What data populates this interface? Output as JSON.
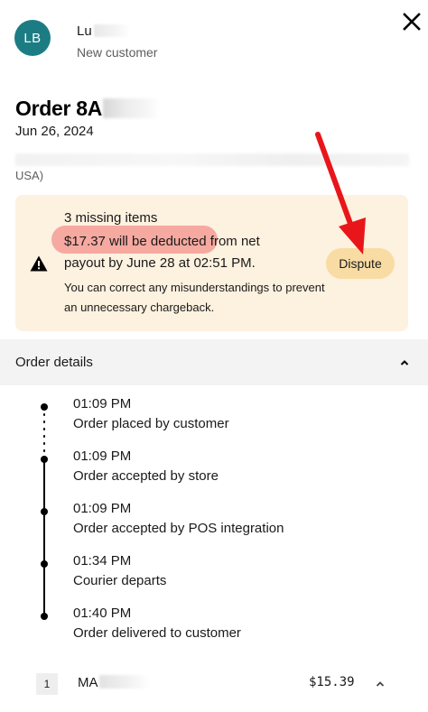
{
  "customer": {
    "initials": "LB",
    "name": "Lu",
    "status": "New customer"
  },
  "order": {
    "title_prefix": "Order 8A",
    "date": "Jun 26, 2024",
    "address_tail": "USA)"
  },
  "warning": {
    "title": "3 missing items",
    "highlighted_text": "$17.37 will be deducted",
    "line1_rest": " from net",
    "line2": "payout by June 28 at 02:51 PM.",
    "note": "You can correct any misunderstandings to prevent an unnecessary chargeback.",
    "dispute_label": "Dispute",
    "highlight_color": "#f6a9a0",
    "card_color": "#fdf1df",
    "button_color": "#f9dca4"
  },
  "annotation": {
    "arrow_color": "#e8161b"
  },
  "details": {
    "label": "Order details",
    "timeline": [
      {
        "time": "01:09 PM",
        "desc": "Order placed by customer"
      },
      {
        "time": "01:09 PM",
        "desc": "Order accepted by store"
      },
      {
        "time": "01:09 PM",
        "desc": "Order accepted by POS integration"
      },
      {
        "time": "01:34 PM",
        "desc": "Courier departs"
      },
      {
        "time": "01:40 PM",
        "desc": "Order delivered to customer"
      }
    ]
  },
  "item": {
    "qty": "1",
    "name": "MA",
    "price": "$15.39"
  }
}
